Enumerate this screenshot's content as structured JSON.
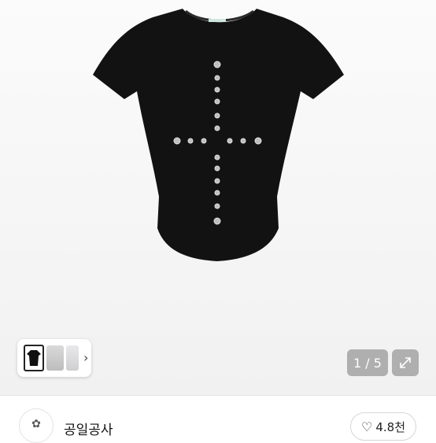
{
  "gallery": {
    "counter": "1 / 5",
    "thumbnails": [
      "black-tee-thumb",
      "model-88-tee-thumb",
      "grey-detail-thumb"
    ],
    "next_icon": "chevron-right-icon",
    "expand_icon": "expand-arrows-icon"
  },
  "product_image": {
    "subject": "black-fitted-tshirt-with-eyelet-cross",
    "background_color": "#f4f4f4",
    "shirt_color": "#121212"
  },
  "seller": {
    "name": "공일공사",
    "avatar_icon": "flower-logo-icon"
  },
  "like": {
    "icon": "heart-outline-icon",
    "count": "4.8천"
  }
}
